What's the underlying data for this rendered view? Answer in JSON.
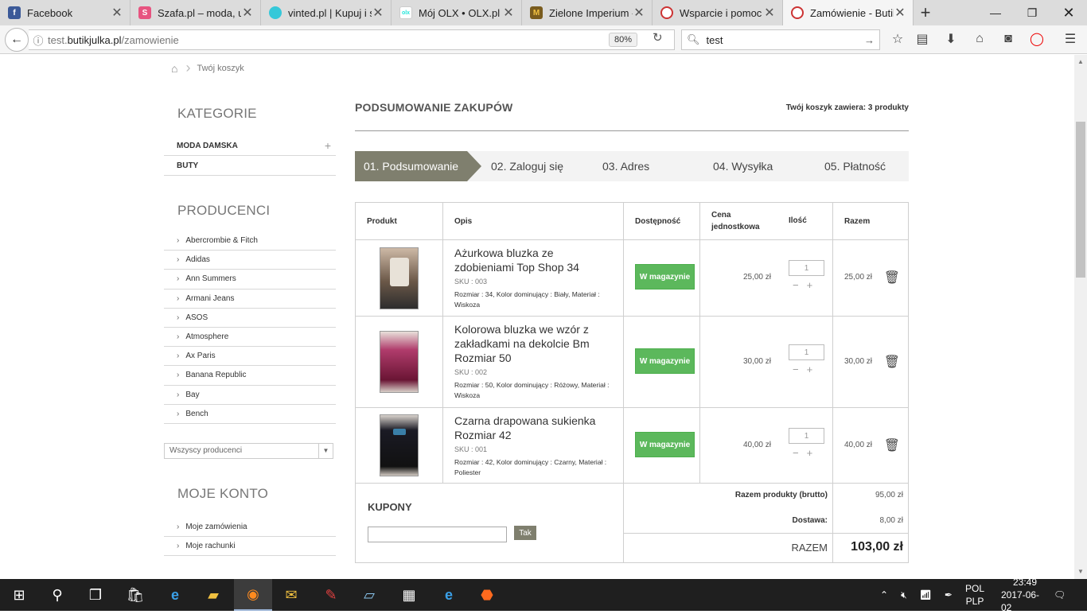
{
  "browser": {
    "tabs": [
      {
        "title": "Facebook",
        "icon": "facebook-icon",
        "color": "#3b5998",
        "glyph": "f"
      },
      {
        "title": "Szafa.pl – moda, ub",
        "icon": "szafa-icon",
        "color": "#e75480",
        "glyph": "S"
      },
      {
        "title": "vinted.pl | Kupuj i sp",
        "icon": "vinted-icon",
        "color": "#35c8d9",
        "glyph": "v"
      },
      {
        "title": "Mój OLX • OLX.pl",
        "icon": "olx-icon",
        "color": "#ffffff",
        "glyph": "olx"
      },
      {
        "title": "Zielone Imperium -",
        "icon": "zielone-imperium-icon",
        "color": "#7a5c1e",
        "glyph": "M"
      },
      {
        "title": "Wsparcie i pomoc u",
        "icon": "support-icon",
        "color": "#cc3333",
        "glyph": "●"
      },
      {
        "title": "Zamówienie - Butik",
        "icon": "butik-icon",
        "color": "#cc3333",
        "glyph": "●"
      }
    ],
    "url_prefix": "test.",
    "url_domain": "butikjulka.pl",
    "url_path": "/zamowienie",
    "zoom": "80%",
    "search_value": "test"
  },
  "breadcrumb": {
    "current": "Twój koszyk"
  },
  "sidebar": {
    "categories_title": "KATEGORIE",
    "categories": [
      "MODA DAMSKA",
      "BUTY"
    ],
    "producers_title": "PRODUCENCI",
    "producers": [
      "Abercrombie & Fitch",
      "Adidas",
      "Ann Summers",
      "Armani Jeans",
      "ASOS",
      "Atmosphere",
      "Ax Paris",
      "Banana Republic",
      "Bay",
      "Bench"
    ],
    "producers_select": "Wszyscy producenci",
    "account_title": "MOJE KONTO",
    "account_links": [
      "Moje zamówienia",
      "Moje rachunki"
    ]
  },
  "main": {
    "title": "PODSUMOWANIE ZAKUPÓW",
    "cart_count": "Twój koszyk zawiera: 3 produkty",
    "steps": [
      "01. Podsumowanie",
      "02. Zaloguj się",
      "03. Adres",
      "04. Wysyłka",
      "05. Płatność"
    ],
    "columns": {
      "product": "Produkt",
      "desc": "Opis",
      "avail": "Dostępność",
      "unit_price_1": "Cena",
      "unit_price_2": "jednostkowa",
      "qty": "Ilość",
      "total": "Razem"
    },
    "items": [
      {
        "name": "Ażurkowa bluzka ze zdobieniami Top Shop 34",
        "sku": "SKU : 003",
        "attrs": "Rozmiar : 34, Kolor dominujący : Biały, Materiał : Wiskoza",
        "avail": "W magazynie",
        "price": "25,00 zł",
        "qty": "1",
        "total": "25,00 zł"
      },
      {
        "name": "Kolorowa bluzka we wzór z zakładkami na dekolcie Bm Rozmiar 50",
        "sku": "SKU : 002",
        "attrs": "Rozmiar : 50, Kolor dominujący : Różowy, Materiał : Wiskoza",
        "avail": "W magazynie",
        "price": "30,00 zł",
        "qty": "1",
        "total": "30,00 zł"
      },
      {
        "name": "Czarna drapowana sukienka Rozmiar 42",
        "sku": "SKU : 001",
        "attrs": "Rozmiar : 42, Kolor dominujący : Czarny, Materiał : Poliester",
        "avail": "W magazynie",
        "price": "40,00 zł",
        "qty": "1",
        "total": "40,00 zł"
      }
    ],
    "coupons_title": "KUPONY",
    "coupon_button": "Tak",
    "summary": {
      "products_label": "Razem produkty (brutto)",
      "products_value": "95,00 zł",
      "shipping_label": "Dostawa:",
      "shipping_value": "8,00 zł",
      "total_label": "RAZEM",
      "total_value": "103,00 zł"
    }
  },
  "taskbar": {
    "lang_1": "POL",
    "lang_2": "PLP",
    "time": "23:49",
    "date": "2017-06-02"
  },
  "colors": {
    "accent": "#7f7f6e",
    "in_stock": "#5cb85c"
  }
}
